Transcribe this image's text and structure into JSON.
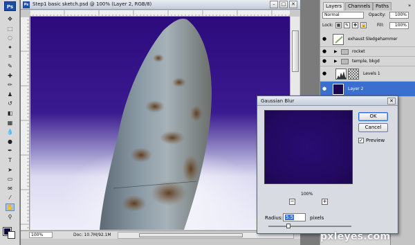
{
  "toolbox": {
    "logo": "Ps",
    "tools": [
      {
        "name": "move-tool",
        "glyph": "✥"
      },
      {
        "name": "marquee-tool",
        "glyph": "⬚"
      },
      {
        "name": "lasso-tool",
        "glyph": "◌"
      },
      {
        "name": "magic-wand-tool",
        "glyph": "✦"
      },
      {
        "name": "crop-tool",
        "glyph": "⌗"
      },
      {
        "name": "slice-tool",
        "glyph": "✎"
      },
      {
        "name": "healing-brush-tool",
        "glyph": "✚"
      },
      {
        "name": "brush-tool",
        "glyph": "✏"
      },
      {
        "name": "clone-stamp-tool",
        "glyph": "♟"
      },
      {
        "name": "history-brush-tool",
        "glyph": "↺"
      },
      {
        "name": "eraser-tool",
        "glyph": "◧"
      },
      {
        "name": "gradient-tool",
        "glyph": "▦"
      },
      {
        "name": "blur-tool",
        "glyph": "💧"
      },
      {
        "name": "dodge-tool",
        "glyph": "●"
      },
      {
        "name": "pen-tool",
        "glyph": "✒"
      },
      {
        "name": "type-tool",
        "glyph": "T"
      },
      {
        "name": "path-selection-tool",
        "glyph": "➤"
      },
      {
        "name": "shape-tool",
        "glyph": "▭"
      },
      {
        "name": "notes-tool",
        "glyph": "✉"
      },
      {
        "name": "eyedropper-tool",
        "glyph": "⁄"
      },
      {
        "name": "hand-tool",
        "glyph": "✋"
      },
      {
        "name": "zoom-tool",
        "glyph": "⚲"
      }
    ],
    "foreground_color": "#0e0444",
    "background_color": "#ffffff"
  },
  "document": {
    "title": "Step1 basic sketch.psd @ 100% (Layer 2, RGB/8)",
    "zoom": "100%",
    "info": "Doc: 10.7M/92.1M",
    "minimize": "–",
    "maximize": "□",
    "close": "✕"
  },
  "layers_panel": {
    "tabs": [
      "Layers",
      "Channels",
      "Paths"
    ],
    "menu": "»",
    "blend_mode": "Normal",
    "opacity_label": "Opacity:",
    "opacity_value": "100%",
    "lock_label": "Lock:",
    "fill_label": "Fill:",
    "fill_value": "100%",
    "layers": [
      {
        "name": "exhaust Sledgehammer",
        "kind": "image"
      },
      {
        "name": "rocket",
        "kind": "group"
      },
      {
        "name": "temple, bkgd",
        "kind": "group"
      },
      {
        "name": "Levels 1",
        "kind": "adjustment"
      },
      {
        "name": "Layer 2",
        "kind": "image",
        "selected": true
      }
    ]
  },
  "dialog": {
    "title": "Gaussian Blur",
    "close": "✕",
    "ok_label": "OK",
    "cancel_label": "Cancel",
    "preview_label": "Preview",
    "preview_checked": "✓",
    "zoom_out": "−",
    "zoom_in": "+",
    "zoom_level": "100%",
    "radius_label": "Radius:",
    "radius_value": "5.5",
    "radius_unit": "pixels",
    "radius_slider_fraction": 0.24
  },
  "watermark": "pxleyes.com"
}
